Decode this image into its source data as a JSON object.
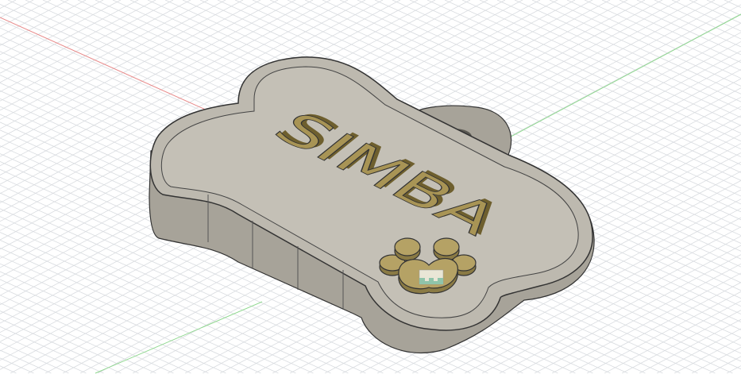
{
  "viewport": {
    "background": "#ffffff",
    "grid_color": "#d9dce0",
    "x_axis_color": "#e88a8a",
    "y_axis_color": "#8fd88f"
  },
  "model": {
    "engraved_text": "SIMBA",
    "body_color": "#b9b5ab",
    "wall_color": "#a7a399",
    "text_color": "#a89455",
    "text_side_color": "#6e5f2e"
  },
  "markers": {
    "sketch_marker_icon": "sketch-glyph-icon"
  }
}
